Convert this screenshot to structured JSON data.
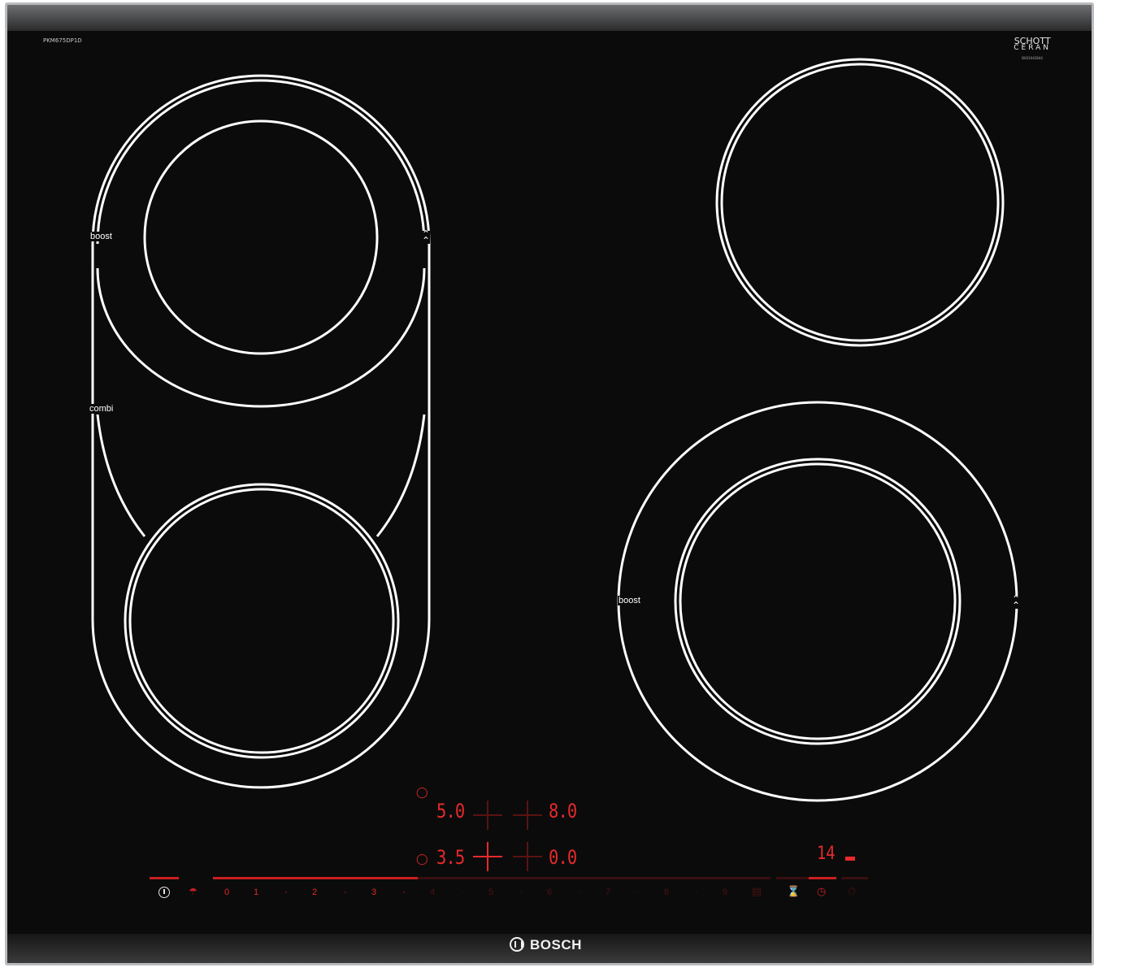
{
  "model_code": "PKM675DP1D",
  "brand": "BOSCH",
  "glass_brand": {
    "line1": "SCHOTT",
    "line2": "CERAN",
    "line3": "B001042844"
  },
  "zone_labels": {
    "left_top_boost": "boost",
    "left_combi": "combi",
    "right_bottom_boost": "boost"
  },
  "displays": {
    "top_left": "5.0",
    "top_right": "8.0",
    "bottom_left": "3.5",
    "bottom_right": "0.0",
    "timer": "14"
  },
  "power_scale": [
    "0",
    "1",
    "·",
    "2",
    "·",
    "3",
    "·",
    "4",
    "·",
    "5",
    "·",
    "6",
    "·",
    "7",
    "·",
    "8",
    "·",
    "9"
  ],
  "colors": {
    "glass": "#0b0b0b",
    "led_red": "#e8292b",
    "frame": "#b9bcbf",
    "rings": "#ffffff"
  },
  "icons": [
    "power-icon",
    "childlock-icon",
    "wipe-protection-icon",
    "timer-icon",
    "stopwatch-icon"
  ]
}
